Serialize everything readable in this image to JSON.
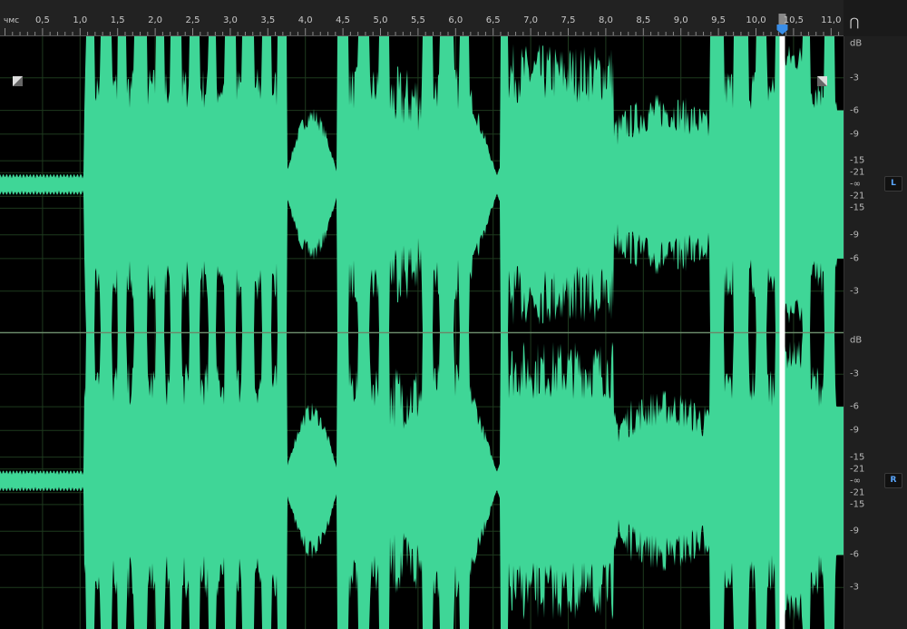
{
  "ruler": {
    "unit": "чмс",
    "ticks": [
      "0,5",
      "1,0",
      "1,5",
      "2,0",
      "2,5",
      "3,0",
      "3,5",
      "4,0",
      "4,5",
      "5,0",
      "5,5",
      "6,0",
      "6,5",
      "7,0",
      "7,5",
      "8,0",
      "8,5",
      "9,0",
      "9,5",
      "10,0",
      "10,5",
      "11,0"
    ]
  },
  "playhead": {
    "time": 10.35
  },
  "channels": [
    {
      "badge": "L",
      "scale": [
        "dB",
        "-3",
        "-6",
        "-9",
        "-15",
        "-21",
        "-∞",
        "-21",
        "-15",
        "-9",
        "-6",
        "-3"
      ]
    },
    {
      "badge": "R",
      "scale": [
        "dB",
        "-3",
        "-6",
        "-9",
        "-15",
        "-21",
        "-∞",
        "-21",
        "-15",
        "-9",
        "-6",
        "-3"
      ]
    }
  ],
  "colors": {
    "waveform": "#3fd697",
    "background": "#000000",
    "playhead": "#ffffff",
    "grid": "#1e3a1e",
    "badge_text": "#5aa7ff"
  },
  "icons": {
    "snap": "magnet-icon"
  }
}
